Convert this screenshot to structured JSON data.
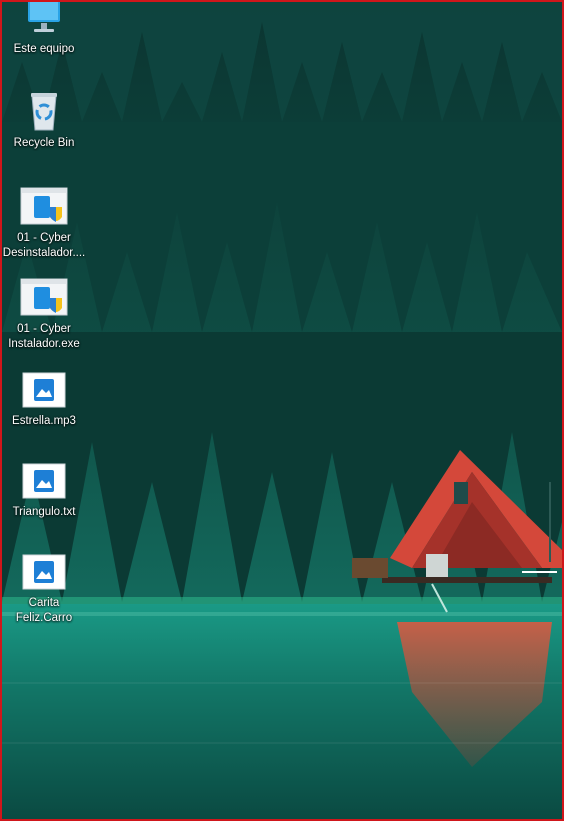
{
  "desktop": {
    "frame_color": "#d0161b",
    "icons": [
      {
        "label_lines": [
          "Este equipo"
        ],
        "icon": "computer-icon"
      },
      {
        "label_lines": [
          "Recycle Bin"
        ],
        "icon": "recycle-bin-icon"
      },
      {
        "label_lines": [
          "01 - Cyber",
          "Desinstalador...."
        ],
        "icon": "installer-shield-icon"
      },
      {
        "label_lines": [
          "01 - Cyber",
          "Instalador.exe"
        ],
        "icon": "installer-shield-icon"
      },
      {
        "label_lines": [
          "Estrella.mp3"
        ],
        "icon": "photos-file-icon"
      },
      {
        "label_lines": [
          "Triangulo.txt"
        ],
        "icon": "photos-file-icon"
      },
      {
        "label_lines": [
          "Carita",
          "Feliz.Carro"
        ],
        "icon": "photos-file-icon"
      }
    ]
  }
}
